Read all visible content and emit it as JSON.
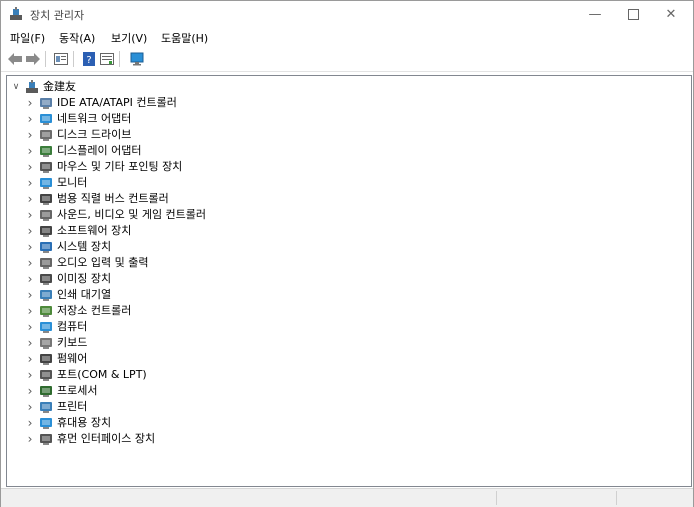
{
  "window": {
    "title": "장치 관리자"
  },
  "menu": [
    {
      "label": "파일(F)"
    },
    {
      "label": "동작(A)"
    },
    {
      "label": "보기(V)"
    },
    {
      "label": "도움말(H)"
    }
  ],
  "toolbar": {
    "buttons": [
      {
        "icon": "back-arrow-icon"
      },
      {
        "icon": "forward-arrow-icon"
      },
      {
        "icon": "properties-icon"
      },
      {
        "icon": "help-icon"
      },
      {
        "icon": "update-driver-icon"
      },
      {
        "icon": "monitor-scan-icon"
      }
    ]
  },
  "tree": {
    "root": {
      "label": "金建友"
    },
    "items": [
      {
        "label": "IDE ATA/ATAPI 컨트롤러",
        "icon": "ide-controller-icon",
        "color": "#5a7fa8"
      },
      {
        "label": "네트워크 어댑터",
        "icon": "network-adapter-icon",
        "color": "#2a8fd6"
      },
      {
        "label": "디스크 드라이브",
        "icon": "disk-drive-icon",
        "color": "#6d6d6d"
      },
      {
        "label": "디스플레이 어댑터",
        "icon": "display-adapter-icon",
        "color": "#3b7d3b"
      },
      {
        "label": "마우스 및 기타 포인팅 장치",
        "icon": "mouse-icon",
        "color": "#555555"
      },
      {
        "label": "모니터",
        "icon": "monitor-icon",
        "color": "#2a8fd6"
      },
      {
        "label": "범용 직렬 버스 컨트롤러",
        "icon": "usb-controller-icon",
        "color": "#444444"
      },
      {
        "label": "사운드, 비디오 및 게임 컨트롤러",
        "icon": "sound-icon",
        "color": "#666666"
      },
      {
        "label": "소프트웨어 장치",
        "icon": "software-device-icon",
        "color": "#444444"
      },
      {
        "label": "시스템 장치",
        "icon": "system-device-icon",
        "color": "#2a6fb5"
      },
      {
        "label": "오디오 입력 및 출력",
        "icon": "audio-io-icon",
        "color": "#666666"
      },
      {
        "label": "이미징 장치",
        "icon": "imaging-device-icon",
        "color": "#4a4a4a"
      },
      {
        "label": "인쇄 대기열",
        "icon": "print-queue-icon",
        "color": "#3a7fb8"
      },
      {
        "label": "저장소 컨트롤러",
        "icon": "storage-controller-icon",
        "color": "#4e8a3b"
      },
      {
        "label": "컴퓨터",
        "icon": "computer-icon",
        "color": "#2a8fd6"
      },
      {
        "label": "키보드",
        "icon": "keyboard-icon",
        "color": "#777777"
      },
      {
        "label": "펌웨어",
        "icon": "firmware-icon",
        "color": "#444444"
      },
      {
        "label": "포트(COM & LPT)",
        "icon": "port-icon",
        "color": "#555555"
      },
      {
        "label": "프로세서",
        "icon": "processor-icon",
        "color": "#2f6b2f"
      },
      {
        "label": "프린터",
        "icon": "printer-icon",
        "color": "#3a7fb8"
      },
      {
        "label": "휴대용 장치",
        "icon": "portable-device-icon",
        "color": "#2a8fd6"
      },
      {
        "label": "휴먼 인터페이스 장치",
        "icon": "hid-icon",
        "color": "#555555"
      }
    ]
  }
}
